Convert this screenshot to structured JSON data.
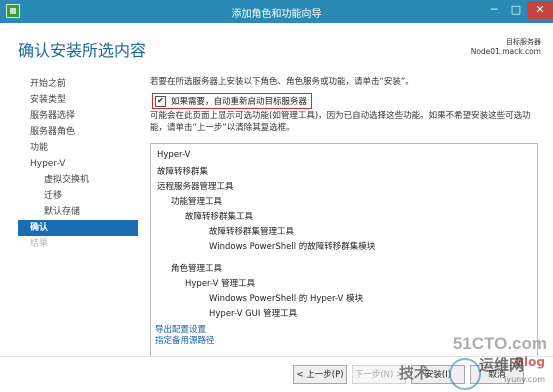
{
  "window": {
    "title": "添加角色和功能向导",
    "minimize_glyph": "─",
    "maximize_glyph": "□",
    "close_glyph": "✕"
  },
  "header": {
    "page_title": "确认安装所选内容",
    "destination_label": "目标服务器",
    "destination_server": "Node01.mack.com"
  },
  "sidebar": {
    "items": [
      {
        "label": "开始之前",
        "state": "normal",
        "indent": false
      },
      {
        "label": "安装类型",
        "state": "normal",
        "indent": false
      },
      {
        "label": "服务器选择",
        "state": "normal",
        "indent": false
      },
      {
        "label": "服务器角色",
        "state": "normal",
        "indent": false
      },
      {
        "label": "功能",
        "state": "normal",
        "indent": false
      },
      {
        "label": "Hyper-V",
        "state": "normal",
        "indent": false
      },
      {
        "label": "虚拟交换机",
        "state": "normal",
        "indent": true
      },
      {
        "label": "迁移",
        "state": "normal",
        "indent": true
      },
      {
        "label": "默认存储",
        "state": "normal",
        "indent": true
      },
      {
        "label": "确认",
        "state": "active",
        "indent": false
      },
      {
        "label": "结果",
        "state": "disabled",
        "indent": false
      }
    ]
  },
  "content": {
    "intro": "若要在所选服务器上安装以下角色、角色服务或功能，请单击“安装”。",
    "restart_checkbox": {
      "checked": true,
      "label": "如果需要，自动重新启动目标服务器"
    },
    "explain": "可能会在此页面上显示可选功能(如管理工具)，因为已自动选择这些功能。如果不希望安装这些可选功能，请单击“上一步”以清除其复选框。",
    "tree": [
      {
        "label": "Hyper-V",
        "level": 0,
        "group": 0
      },
      {
        "label": "故障转移群集",
        "level": 0,
        "group": 0
      },
      {
        "label": "远程服务器管理工具",
        "level": 0,
        "group": 0
      },
      {
        "label": "功能管理工具",
        "level": 1,
        "group": 0
      },
      {
        "label": "故障转移群集工具",
        "level": 2,
        "group": 0
      },
      {
        "label": "故障转移群集管理工具",
        "level": 3,
        "group": 0
      },
      {
        "label": "Windows PowerShell 的故障转移群集模块",
        "level": 3,
        "group": 0
      },
      {
        "label": "角色管理工具",
        "level": 1,
        "group": 1
      },
      {
        "label": "Hyper-V 管理工具",
        "level": 2,
        "group": 1
      },
      {
        "label": "Windows PowerShell 的 Hyper-V 模块",
        "level": 3,
        "group": 1
      },
      {
        "label": "Hyper-V GUI 管理工具",
        "level": 3,
        "group": 1
      }
    ],
    "export_link": "导出配置设置",
    "alt_source_link": "指定备用源路径"
  },
  "footer": {
    "prev": "< 上一步(P)",
    "next": "下一步(N) >",
    "install": "安装(I)",
    "cancel": "取消"
  },
  "watermark": {
    "brand": "51CTO.com",
    "blog": "Blog",
    "tech": "技术",
    "site": "运维网",
    "url": "iyunv.com"
  },
  "colors": {
    "titlebar": "#2a8ab5",
    "accent": "#1a6cb4",
    "highlight_border": "#d42a2a"
  }
}
